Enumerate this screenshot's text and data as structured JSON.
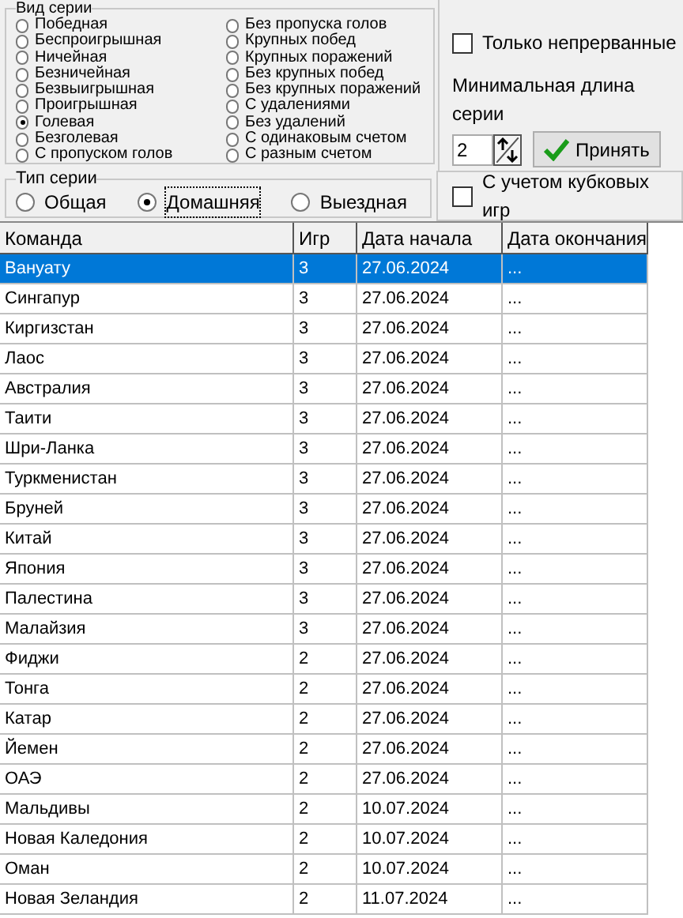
{
  "series_kind": {
    "title": "Вид серии",
    "options": [
      {
        "label": "Победная",
        "selected": false
      },
      {
        "label": "Беспроигрышная",
        "selected": false
      },
      {
        "label": "Ничейная",
        "selected": false
      },
      {
        "label": "Безничейная",
        "selected": false
      },
      {
        "label": "Безвыигрышная",
        "selected": false
      },
      {
        "label": "Проигрышная",
        "selected": false
      },
      {
        "label": "Голевая",
        "selected": true
      },
      {
        "label": "Безголевая",
        "selected": false
      },
      {
        "label": "С пропуском голов",
        "selected": false
      },
      {
        "label": "Без пропуска голов",
        "selected": false
      },
      {
        "label": "Крупных побед",
        "selected": false
      },
      {
        "label": "Крупных поражений",
        "selected": false
      },
      {
        "label": "Без крупных побед",
        "selected": false
      },
      {
        "label": "Без крупных поражений",
        "selected": false
      },
      {
        "label": "С удалениями",
        "selected": false
      },
      {
        "label": "Без удалений",
        "selected": false
      },
      {
        "label": "С одинаковым счетом",
        "selected": false
      },
      {
        "label": "С разным счетом",
        "selected": false
      }
    ]
  },
  "only_continuous": {
    "label": "Только непрерванные",
    "checked": false
  },
  "min_length": {
    "label": "Минимальная длина серии",
    "value": "2"
  },
  "apply_button": "Принять",
  "series_type": {
    "title": "Тип серии",
    "options": [
      {
        "label": "Общая",
        "selected": false
      },
      {
        "label": "Домашняя",
        "selected": true
      },
      {
        "label": "Выездная",
        "selected": false
      }
    ]
  },
  "cup_games": {
    "label": "С учетом кубковых игр",
    "checked": false
  },
  "table": {
    "columns": [
      "Команда",
      "Игр",
      "Дата начала",
      "Дата окончания"
    ],
    "rows": [
      {
        "cells": [
          "Вануату",
          "3",
          "27.06.2024",
          "..."
        ],
        "selected": true
      },
      {
        "cells": [
          "Сингапур",
          "3",
          "27.06.2024",
          "..."
        ],
        "selected": false
      },
      {
        "cells": [
          "Киргизстан",
          "3",
          "27.06.2024",
          "..."
        ],
        "selected": false
      },
      {
        "cells": [
          "Лаос",
          "3",
          "27.06.2024",
          "..."
        ],
        "selected": false
      },
      {
        "cells": [
          "Австралия",
          "3",
          "27.06.2024",
          "..."
        ],
        "selected": false
      },
      {
        "cells": [
          "Таити",
          "3",
          "27.06.2024",
          "..."
        ],
        "selected": false
      },
      {
        "cells": [
          "Шри-Ланка",
          "3",
          "27.06.2024",
          "..."
        ],
        "selected": false
      },
      {
        "cells": [
          "Туркменистан",
          "3",
          "27.06.2024",
          "..."
        ],
        "selected": false
      },
      {
        "cells": [
          "Бруней",
          "3",
          "27.06.2024",
          "..."
        ],
        "selected": false
      },
      {
        "cells": [
          "Китай",
          "3",
          "27.06.2024",
          "..."
        ],
        "selected": false
      },
      {
        "cells": [
          "Япония",
          "3",
          "27.06.2024",
          "..."
        ],
        "selected": false
      },
      {
        "cells": [
          "Палестина",
          "3",
          "27.06.2024",
          "..."
        ],
        "selected": false
      },
      {
        "cells": [
          "Малайзия",
          "3",
          "27.06.2024",
          "..."
        ],
        "selected": false
      },
      {
        "cells": [
          "Фиджи",
          "2",
          "27.06.2024",
          "..."
        ],
        "selected": false
      },
      {
        "cells": [
          "Тонга",
          "2",
          "27.06.2024",
          "..."
        ],
        "selected": false
      },
      {
        "cells": [
          "Катар",
          "2",
          "27.06.2024",
          "..."
        ],
        "selected": false
      },
      {
        "cells": [
          "Йемен",
          "2",
          "27.06.2024",
          "..."
        ],
        "selected": false
      },
      {
        "cells": [
          "ОАЭ",
          "2",
          "27.06.2024",
          "..."
        ],
        "selected": false
      },
      {
        "cells": [
          "Мальдивы",
          "2",
          "10.07.2024",
          "..."
        ],
        "selected": false
      },
      {
        "cells": [
          "Новая Каледония",
          "2",
          "10.07.2024",
          "..."
        ],
        "selected": false
      },
      {
        "cells": [
          "Оман",
          "2",
          "10.07.2024",
          "..."
        ],
        "selected": false
      },
      {
        "cells": [
          "Новая Зеландия",
          "2",
          "11.07.2024",
          "..."
        ],
        "selected": false
      }
    ]
  }
}
